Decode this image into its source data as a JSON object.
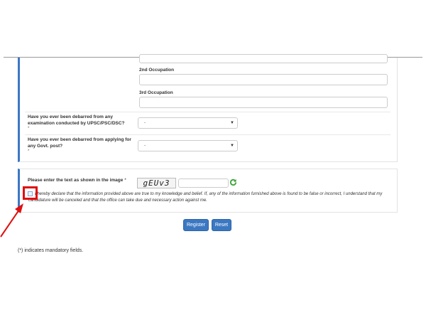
{
  "form": {
    "occupation2_label": "2nd Occupation",
    "occupation3_label": "3rd Occupation",
    "debarred_exam_question": "Have you ever been debarred from any examination conducted by UPSC/PSC/DSC?",
    "debarred_exam_value": "-",
    "debarred_govt_question": "Have you ever been debarred from applying for any Govt. post?",
    "debarred_govt_value": "-",
    "required_mark": "*",
    "captcha_label": "Please enter the text as shown in the image",
    "captcha_text": "gEUv3",
    "declaration": "I hereby declare that the information provided above are true to my knowledge and belief. If, any of the information furnished above is found to be false or incorrect, I understand that my candidature will be canceled and that the office can take due and necessary action against me.",
    "register_label": "Register",
    "reset_label": "Reset",
    "footnote": "(*) indicates mandatory fields."
  },
  "colors": {
    "accent": "#3b78c2",
    "highlight": "#e01010",
    "refresh_icon": "#3aa335"
  },
  "icons": [
    "refresh-icon",
    "caret-down-icon",
    "red-arrow-annotation"
  ]
}
